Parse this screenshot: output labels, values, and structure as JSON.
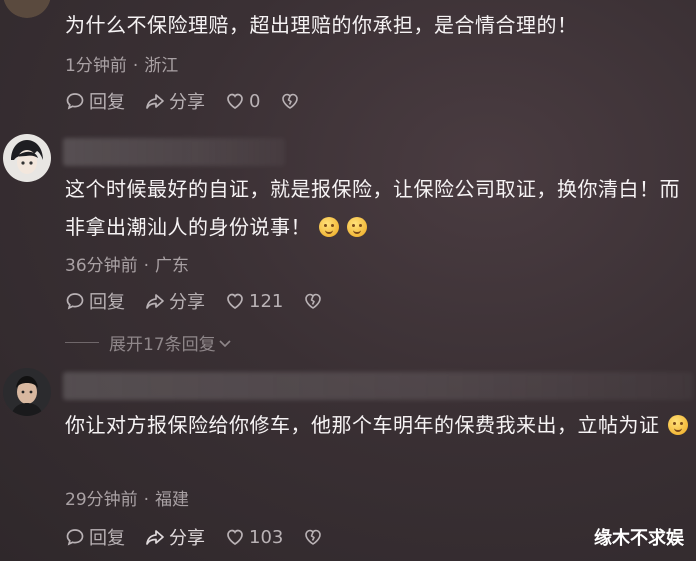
{
  "comments": [
    {
      "text": "为什么不保险理赔，超出理赔的你承担，是合情合理的！",
      "time": "1分钟前",
      "location": "浙江",
      "reply_label": "回复",
      "share_label": "分享",
      "likes": "0"
    },
    {
      "text": "这个时候最好的自证，就是报保险，让保险公司取证，换你清白！而非拿出潮汕人的身份说事！",
      "emoji_count": 2,
      "time": "36分钟前",
      "location": "广东",
      "reply_label": "回复",
      "share_label": "分享",
      "likes": "121",
      "expand_label": "展开17条回复"
    },
    {
      "text": "你让对方报保险给你修车，他那个车明年的保费我来出，立帖为证",
      "emoji_count": 1,
      "time": "29分钟前",
      "location": "福建",
      "reply_label": "回复",
      "share_label": "分享",
      "likes": "103"
    }
  ],
  "separator": "·",
  "watermark": "缘木不求娱",
  "icons": [
    "comment-icon",
    "share-icon",
    "heart-icon",
    "broken-heart-icon",
    "chevron-down-icon"
  ],
  "colors": {
    "background": "#3a3034",
    "text": "#f6f3f4",
    "meta": "#a9a1a4"
  }
}
